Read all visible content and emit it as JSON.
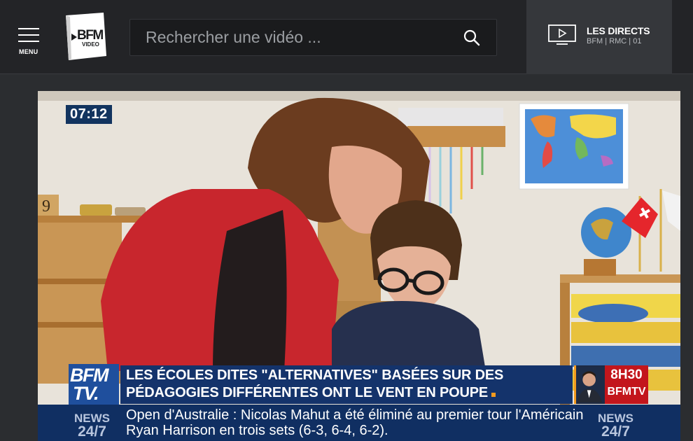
{
  "header": {
    "menu_label": "MENU",
    "logo_text_main": "BFM",
    "logo_text_sub": "VIDEO",
    "search": {
      "placeholder": "Rechercher une vidéo ...",
      "value": ""
    },
    "live": {
      "title": "LES DIRECTS",
      "subtitle": "BFM | RMC | 01"
    }
  },
  "video": {
    "duration": "07:12",
    "overlay": {
      "channel_logo_line1": "BFM",
      "channel_logo_line2": "TV.",
      "headline_line1": "LES ÉCOLES DITES \"ALTERNATIVES\" BASÉES SUR DES",
      "headline_line2": "PÉDAGOGIES DIFFÉRENTES ONT LE VENT EN POUPE",
      "show_time": "8H30",
      "show_channel": "BFMTV",
      "news_label_top": "NEWS",
      "news_label_bottom": "24/7",
      "ticker_text": "Open d'Australie : Nicolas Mahut a été éliminé au premier tour l'Américain Ryan Harrison en trois sets (6-3, 6-4, 6-2)."
    }
  },
  "colors": {
    "header_bg": "#232427",
    "page_bg": "#2b2d30",
    "live_bg": "#35373b",
    "overlay_blue": "#14336b",
    "accent_orange": "#f39a1e",
    "accent_red": "#c3161c"
  },
  "icons": {
    "menu": "hamburger-icon",
    "search": "search-icon",
    "live": "tv-play-icon"
  }
}
